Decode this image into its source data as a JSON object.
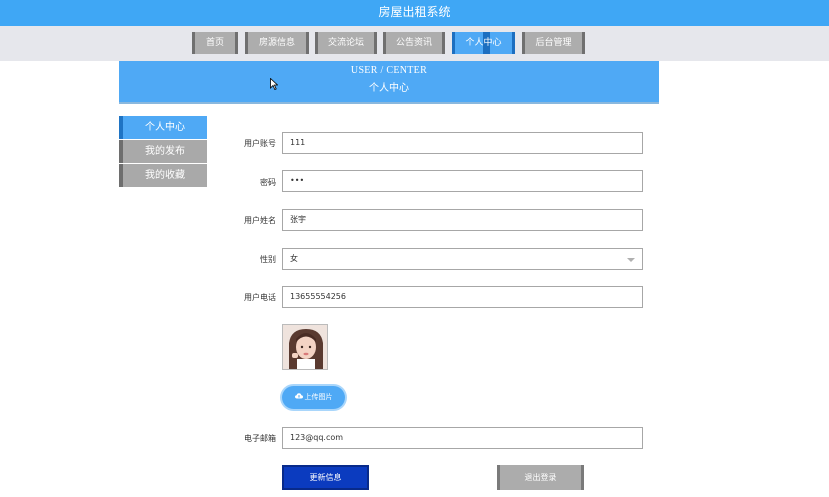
{
  "header": {
    "title": "房屋出租系统"
  },
  "nav": {
    "items": [
      {
        "label": "首页"
      },
      {
        "label": "房源信息"
      },
      {
        "label": "交流论坛"
      },
      {
        "label": "公告资讯"
      },
      {
        "label": "个人中心"
      },
      {
        "label": "后台管理"
      }
    ],
    "active_index": 4
  },
  "banner": {
    "title_en": "USER / CENTER",
    "title_cn": "个人中心"
  },
  "sidebar": {
    "items": [
      {
        "label": "个人中心"
      },
      {
        "label": "我的发布"
      },
      {
        "label": "我的收藏"
      }
    ],
    "active_index": 0
  },
  "form": {
    "username": {
      "label": "用户账号",
      "value": "111"
    },
    "password": {
      "label": "密码",
      "value": "•••"
    },
    "realname": {
      "label": "用户姓名",
      "value": "张宇"
    },
    "gender": {
      "label": "性别",
      "value": "女"
    },
    "phone": {
      "label": "用户电话",
      "value": "13655554256"
    },
    "upload_label": "上传图片",
    "email": {
      "label": "电子邮箱",
      "value": "123@qq.com"
    },
    "update_label": "更新信息",
    "logout_label": "退出登录"
  },
  "icons": {
    "upload": "cloud-upload-icon",
    "dropdown": "chevron-down-icon",
    "cursor": "mouse-pointer-icon"
  },
  "colors": {
    "primary": "#4fa9f5",
    "header": "#3fa7f5",
    "update_button": "#0b3bbf",
    "inactive": "#acacac"
  }
}
